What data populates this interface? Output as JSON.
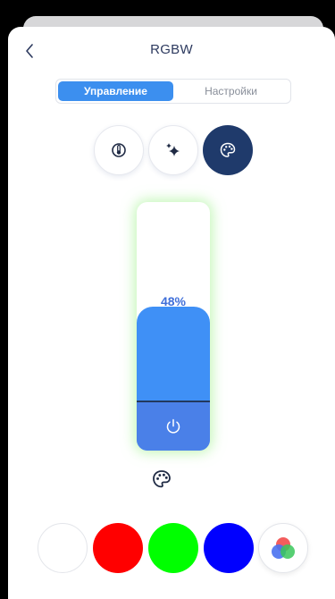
{
  "header": {
    "title": "RGBW"
  },
  "tabs": [
    {
      "label": "Управление",
      "active": true
    },
    {
      "label": "Настройки",
      "active": false
    }
  ],
  "modes": [
    {
      "icon": "thermometer-icon",
      "active": false
    },
    {
      "icon": "sparkle-icon",
      "active": false
    },
    {
      "icon": "palette-icon",
      "active": true
    }
  ],
  "brightness": {
    "percent_label": "48%",
    "value": 48
  },
  "swatches": [
    {
      "name": "white",
      "color": "#ffffff"
    },
    {
      "name": "red",
      "color": "#ff0000"
    },
    {
      "name": "green",
      "color": "#00ff00"
    },
    {
      "name": "blue",
      "color": "#0000ff"
    },
    {
      "name": "multicolor",
      "color": "mixed"
    }
  ],
  "colors": {
    "accent": "#3c8fef",
    "dark_button": "#1f3a6b",
    "slider_glow": "#96f082"
  }
}
